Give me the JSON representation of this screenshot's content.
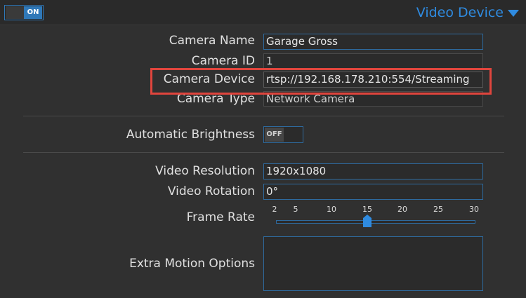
{
  "header": {
    "toggle_label": "ON",
    "section_title": "Video Device"
  },
  "fields": {
    "camera_name": {
      "label": "Camera Name",
      "value": "Garage Gross"
    },
    "camera_id": {
      "label": "Camera ID",
      "value": "1"
    },
    "camera_device": {
      "label": "Camera Device",
      "value": "rtsp://192.168.178.210:554/Streaming"
    },
    "camera_type": {
      "label": "Camera Type",
      "value": "Network Camera"
    },
    "automatic_brightness": {
      "label": "Automatic Brightness",
      "value": "OFF"
    },
    "video_resolution": {
      "label": "Video Resolution",
      "value": "1920x1080"
    },
    "video_rotation": {
      "label": "Video Rotation",
      "value": "0°"
    },
    "frame_rate": {
      "label": "Frame Rate",
      "ticks": [
        "2",
        "5",
        "10",
        "15",
        "20",
        "25",
        "30"
      ],
      "value": 15
    },
    "extra_motion_options": {
      "label": "Extra Motion Options",
      "value": ""
    }
  },
  "colors": {
    "accent": "#2f8be0",
    "highlight": "#e0453d",
    "background": "#303030"
  }
}
